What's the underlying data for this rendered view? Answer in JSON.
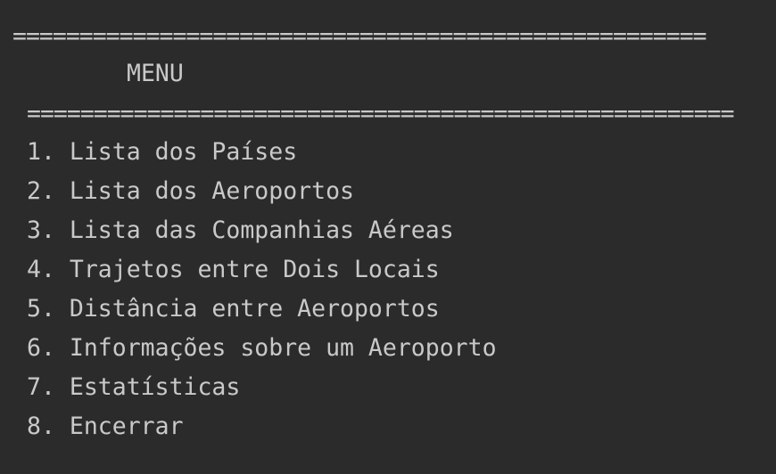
{
  "console": {
    "separator_top": "====================================================",
    "title": "MENU",
    "separator_mid": "=====================================================",
    "items": [
      {
        "number": "1.",
        "label": "Lista dos Países"
      },
      {
        "number": "2.",
        "label": "Lista dos Aeroportos"
      },
      {
        "number": "3.",
        "label": "Lista das Companhias Aéreas"
      },
      {
        "number": "4.",
        "label": "Trajetos entre Dois Locais"
      },
      {
        "number": "5.",
        "label": "Distância entre Aeroportos"
      },
      {
        "number": "6.",
        "label": "Informações sobre um Aeroporto"
      },
      {
        "number": "7.",
        "label": "Estatísticas"
      },
      {
        "number": "8.",
        "label": "Encerrar"
      }
    ]
  },
  "colors": {
    "background": "#2b2b2b",
    "text": "#c9c9c9"
  }
}
